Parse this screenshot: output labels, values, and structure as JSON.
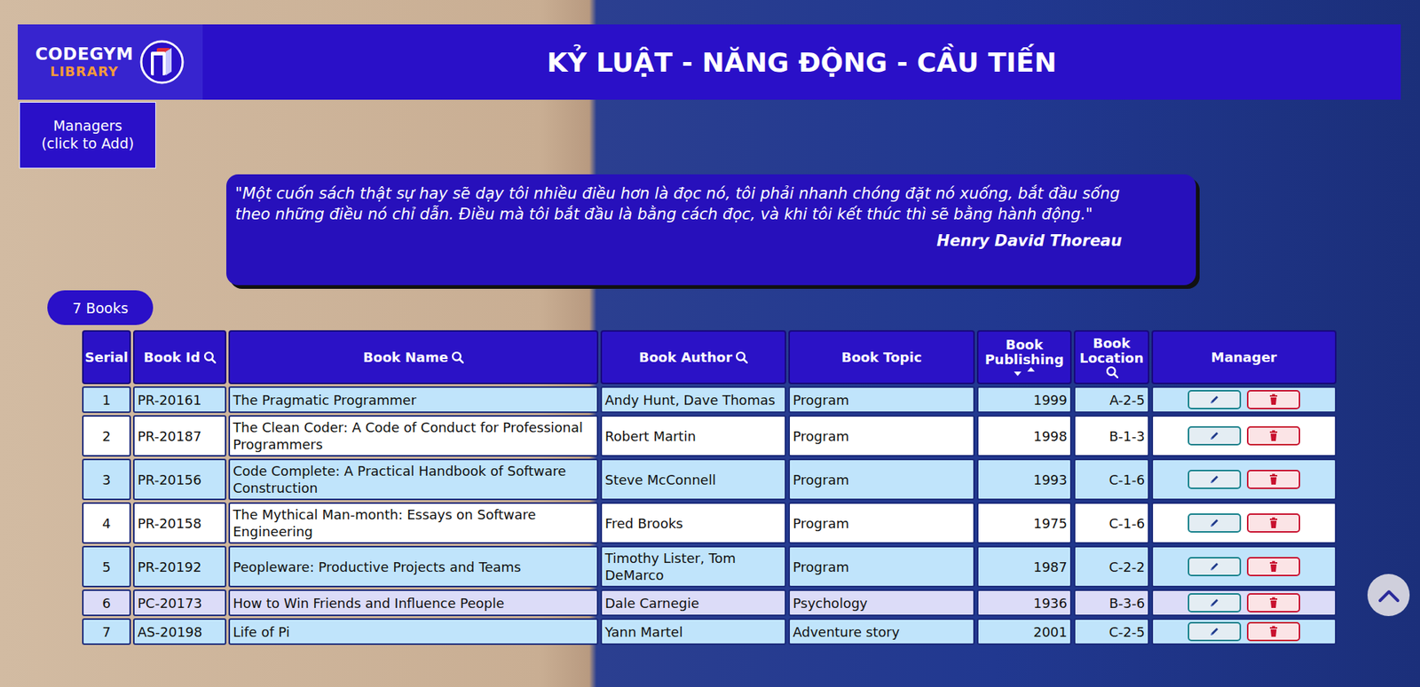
{
  "logo": {
    "line1": "CODEGYM",
    "line2": "LIBRARY"
  },
  "header": {
    "title": "KỶ LUẬT - NĂNG ĐỘNG - CẦU TIẾN"
  },
  "managers_button": {
    "line1": "Managers",
    "line2": "(click to Add)"
  },
  "quote": {
    "text": "\"Một cuốn sách thật sự hay sẽ dạy tôi nhiều điều hơn là đọc nó, tôi phải nhanh chóng đặt nó xuống, bắt đầu sống theo những điều nó chỉ dẫn. Điều mà tôi bắt đầu là bằng cách đọc, và khi tôi kết thúc thì sẽ bằng hành động.\"",
    "author": "Henry David Thoreau"
  },
  "book_count": "7 Books",
  "table": {
    "columns": [
      {
        "label": "Serial",
        "kind": "plain"
      },
      {
        "label": "Book Id",
        "kind": "search"
      },
      {
        "label": "Book Name",
        "kind": "search"
      },
      {
        "label": "Book Author",
        "kind": "search"
      },
      {
        "label": "Book Topic",
        "kind": "plain"
      },
      {
        "label": "Book Publishing",
        "kind": "sort"
      },
      {
        "label": "Book Location",
        "kind": "search"
      },
      {
        "label": "Manager",
        "kind": "plain"
      }
    ],
    "rows": [
      {
        "cells": [
          "1",
          "PR-20161",
          "The Pragmatic Programmer",
          "Andy Hunt, Dave Thomas",
          "Program",
          "1999",
          "A-2-5"
        ],
        "highlighted": false
      },
      {
        "cells": [
          "2",
          "PR-20187",
          "The Clean Coder: A Code of Conduct for Professional Programmers",
          "Robert Martin",
          "Program",
          "1998",
          "B-1-3"
        ],
        "highlighted": false
      },
      {
        "cells": [
          "3",
          "PR-20156",
          "Code Complete: A Practical Handbook of Software Construction",
          "Steve McConnell",
          "Program",
          "1993",
          "C-1-6"
        ],
        "highlighted": false
      },
      {
        "cells": [
          "4",
          "PR-20158",
          "The Mythical Man-month: Essays on Software Engineering",
          "Fred Brooks",
          "Program",
          "1975",
          "C-1-6"
        ],
        "highlighted": false
      },
      {
        "cells": [
          "5",
          "PR-20192",
          "Peopleware: Productive Projects and Teams",
          "Timothy Lister, Tom DeMarco",
          "Program",
          "1987",
          "C-2-2"
        ],
        "highlighted": false
      },
      {
        "cells": [
          "6",
          "PC-20173",
          "How to Win Friends and Influence People",
          "Dale Carnegie",
          "Psychology",
          "1936",
          "B-3-6"
        ],
        "highlighted": true
      },
      {
        "cells": [
          "7",
          "AS-20198",
          "Life of Pi",
          "Yann Martel",
          "Adventure story",
          "2001",
          "C-2-5"
        ],
        "highlighted": false
      }
    ]
  }
}
